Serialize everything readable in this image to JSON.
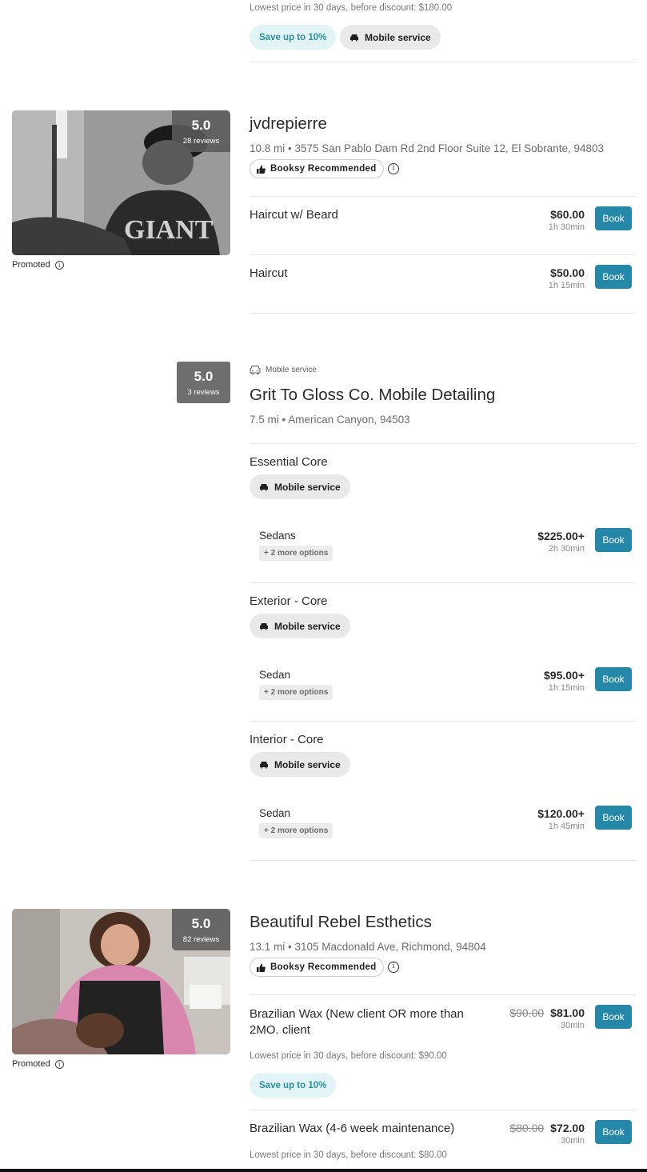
{
  "top_listing": {
    "lowest_price_note": "Lowest price in 30 days, before discount: $180.00",
    "save_badge": "Save up to 10%",
    "mobile_badge": "Mobile service"
  },
  "listing1": {
    "name": "jvdrepierre",
    "rating": "5.0",
    "reviews": "28 reviews",
    "address": "10.8 mi • 3575 San Pablo Dam Rd 2nd Floor Suite 12, El Sobrante, 94803",
    "recommended": "Booksy Recommended",
    "promoted": "Promoted",
    "services": [
      {
        "name": "Haircut w/ Beard",
        "price": "$60.00",
        "duration": "1h 30min",
        "book": "Book"
      },
      {
        "name": "Haircut",
        "price": "$50.00",
        "duration": "1h 15min",
        "book": "Book"
      }
    ]
  },
  "listing2": {
    "tag": "Mobile service",
    "name": "Grit To Gloss Co. Mobile Detailing",
    "rating": "5.0",
    "reviews": "3 reviews",
    "address": "7.5 mi • American Canyon, 94503",
    "groups": [
      {
        "name": "Essential Core",
        "badge": "Mobile service",
        "option": "Sedans",
        "more": "+ 2 more options",
        "price": "$225.00+",
        "duration": "2h 30min",
        "book": "Book"
      },
      {
        "name": "Exterior - Core",
        "badge": "Mobile service",
        "option": "Sedan",
        "more": "+ 2 more options",
        "price": "$95.00+",
        "duration": "1h 15min",
        "book": "Book"
      },
      {
        "name": "Interior - Core",
        "badge": "Mobile service",
        "option": "Sedan",
        "more": "+ 2 more options",
        "price": "$120.00+",
        "duration": "1h 45min",
        "book": "Book"
      }
    ]
  },
  "listing3": {
    "name": "Beautiful Rebel Esthetics",
    "rating": "5.0",
    "reviews": "82 reviews",
    "address": "13.1 mi • 3105 Macdonald Ave, Richmond, 94804",
    "recommended": "Booksy Recommended",
    "promoted": "Promoted",
    "services": [
      {
        "name_line1": "Brazilian Wax (New client OR more than",
        "name_line2": "2MO. client",
        "old_price": "$90.00",
        "price": "$81.00",
        "duration": "30min",
        "book": "Book",
        "lowest": "Lowest price in 30 days, before discount: $90.00",
        "save": "Save up to 10%"
      },
      {
        "name": "Brazilian Wax (4-6 week maintenance)",
        "old_price": "$80.00",
        "price": "$72.00",
        "duration": "30min",
        "book": "Book",
        "lowest": "Lowest price in 30 days, before discount: $80.00"
      }
    ]
  },
  "colors": {
    "accent": "#2688a8",
    "save_bg": "#e3f4f6",
    "save_text": "#2a8fa0"
  },
  "icons": [
    "car-icon",
    "thumbs-up-icon",
    "info-icon"
  ]
}
